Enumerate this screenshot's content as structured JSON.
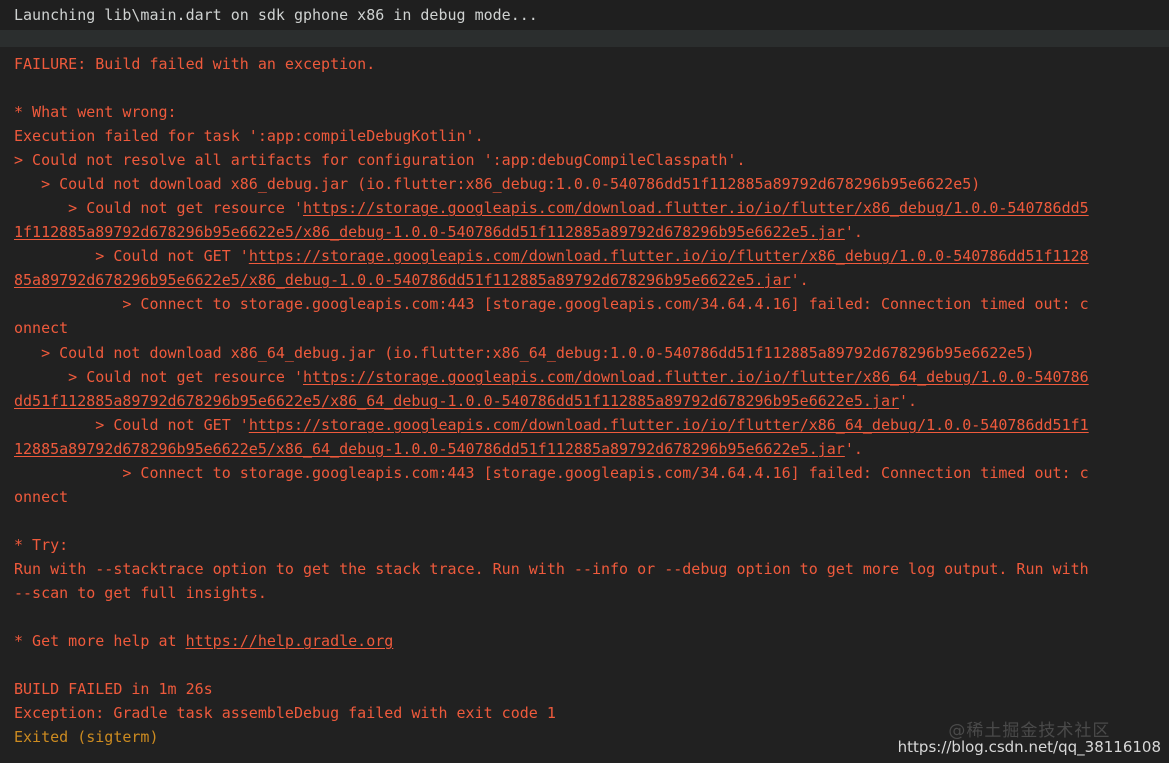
{
  "terminal": {
    "title_line": "Launching lib\\main.dart on sdk gphone x86 in debug mode...",
    "background": "#212121",
    "header_band_color": "#1f1f1f",
    "separator_band_color": "#2b2e2e",
    "error_color": "#ef5a3c",
    "warning_color": "#cc8b20",
    "header_text_color": "#cfd2d1"
  },
  "lines": {
    "l01": "FAILURE: Build failed with an exception.",
    "l02": "* What went wrong:",
    "l03": "Execution failed for task ':app:compileDebugKotlin'.",
    "l04": "> Could not resolve all artifacts for configuration ':app:debugCompileClasspath'.",
    "l05": "   > Could not download x86_debug.jar (io.flutter:x86_debug:1.0.0-540786dd51f112885a89792d678296b95e6622e5)",
    "l06_pre": "      > Could not get resource '",
    "l06_url_a": "https://storage.googleapis.com/download.flutter.io/io/flutter/x86_debug/1.0.0-540786dd5",
    "l06_url_b": "1f112885a89792d678296b95e6622e5/x86_debug-1.0.0-540786dd51f112885a89792d678296b95e6622e5.jar",
    "l06_post": "'.",
    "l07_pre": "         > Could not GET '",
    "l07_url_a": "https://storage.googleapis.com/download.flutter.io/io/flutter/x86_debug/1.0.0-540786dd51f1128",
    "l07_url_b": "85a89792d678296b95e6622e5/x86_debug-1.0.0-540786dd51f112885a89792d678296b95e6622e5.jar",
    "l07_post": "'.",
    "l08_a": "            > Connect to storage.googleapis.com:443 [storage.googleapis.com/34.64.4.16] failed: Connection timed out: c",
    "l08_b": "onnect",
    "l09": "   > Could not download x86_64_debug.jar (io.flutter:x86_64_debug:1.0.0-540786dd51f112885a89792d678296b95e6622e5)",
    "l10_pre": "      > Could not get resource '",
    "l10_url_a": "https://storage.googleapis.com/download.flutter.io/io/flutter/x86_64_debug/1.0.0-540786",
    "l10_url_b": "dd51f112885a89792d678296b95e6622e5/x86_64_debug-1.0.0-540786dd51f112885a89792d678296b95e6622e5.jar",
    "l10_post": "'.",
    "l11_pre": "         > Could not GET '",
    "l11_url_a": "https://storage.googleapis.com/download.flutter.io/io/flutter/x86_64_debug/1.0.0-540786dd51f1",
    "l11_url_b": "12885a89792d678296b95e6622e5/x86_64_debug-1.0.0-540786dd51f112885a89792d678296b95e6622e5.jar",
    "l11_post": "'.",
    "l12_a": "            > Connect to storage.googleapis.com:443 [storage.googleapis.com/34.64.4.16] failed: Connection timed out: c",
    "l12_b": "onnect",
    "l13": "* Try:",
    "l14_a": "Run with --stacktrace option to get the stack trace. Run with --info or --debug option to get more log output. Run with",
    "l14_b": "--scan to get full insights.",
    "l15_pre": "* Get more help at ",
    "l15_url": "https://help.gradle.org",
    "l16": "BUILD FAILED in 1m 26s",
    "l17": "Exception: Gradle task assembleDebug failed with exit code 1",
    "l18": "Exited (sigterm)"
  },
  "watermark": {
    "community": "@稀土掘金技术社区",
    "url": "https://blog.csdn.net/qq_38116108"
  }
}
